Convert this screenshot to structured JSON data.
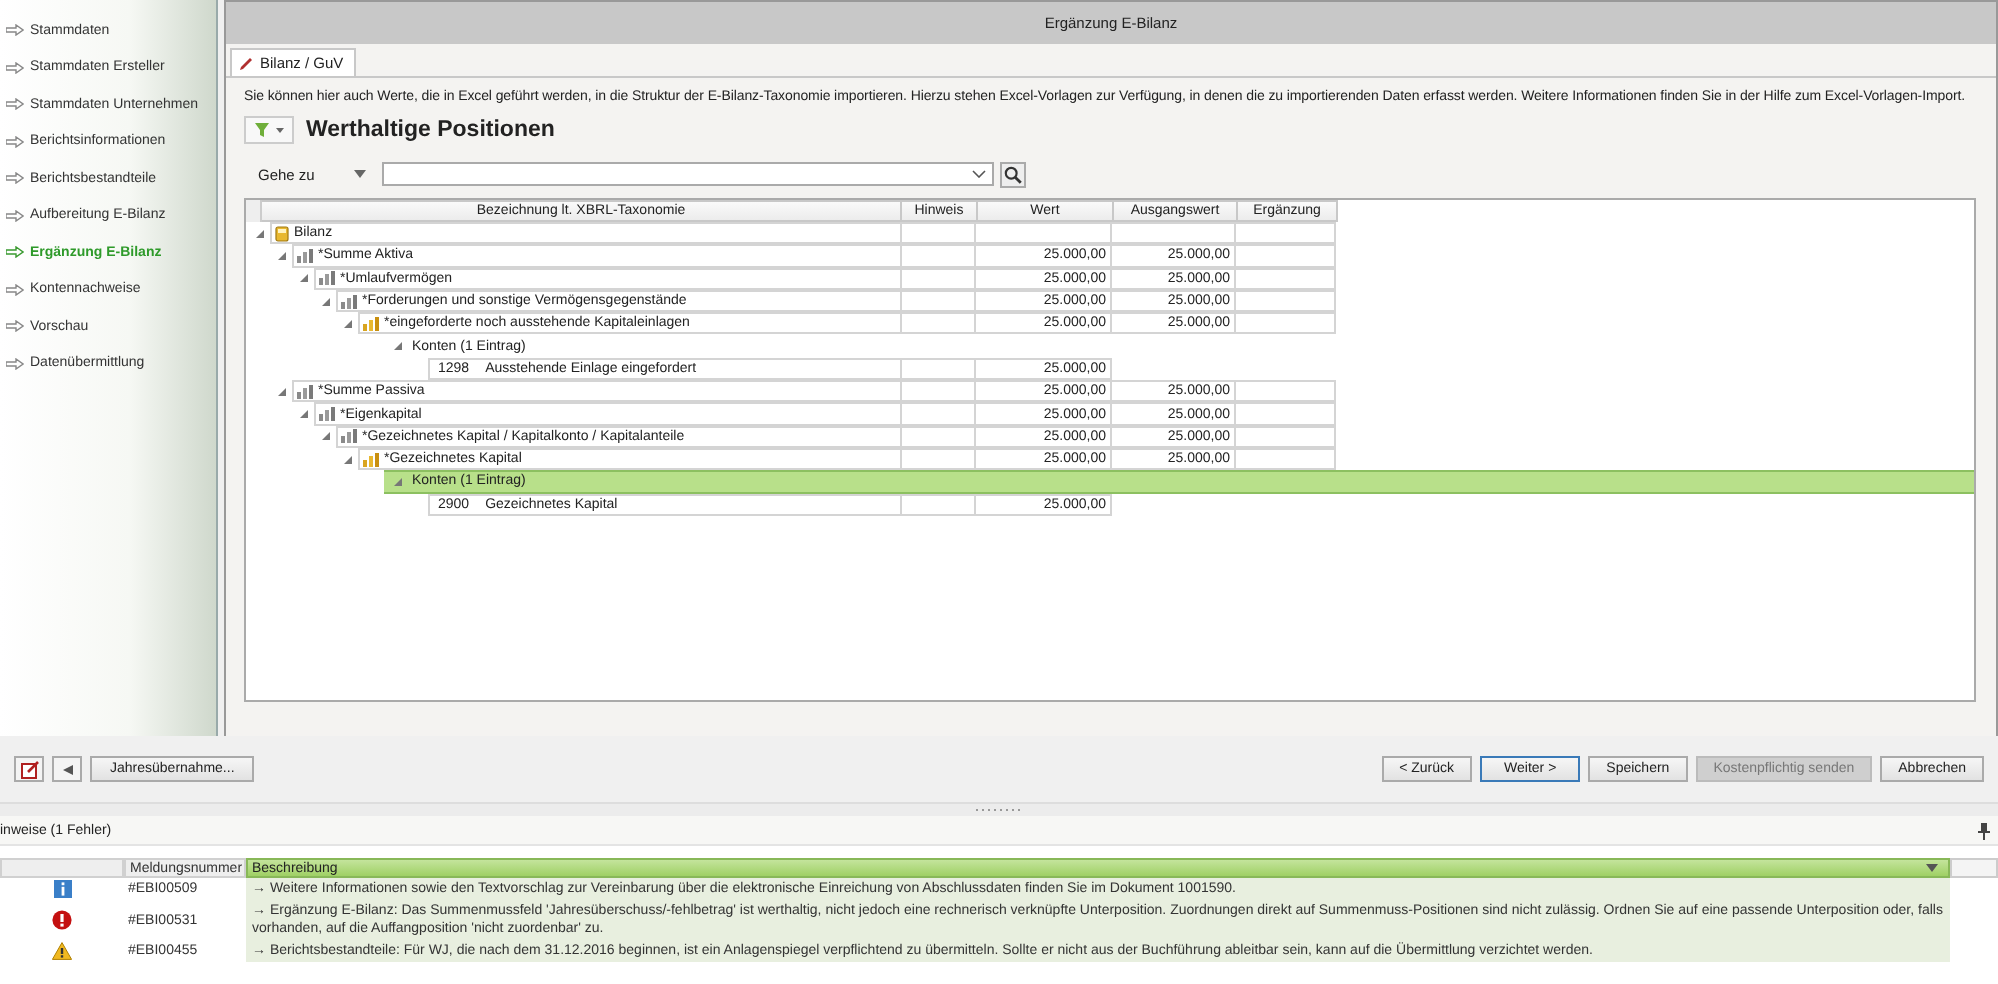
{
  "sidebar": {
    "items": [
      {
        "label": "Stammdaten",
        "selected": false
      },
      {
        "label": "Stammdaten Ersteller",
        "selected": false
      },
      {
        "label": "Stammdaten Unternehmen",
        "selected": false
      },
      {
        "label": "Berichtsinformationen",
        "selected": false
      },
      {
        "label": "Berichtsbestandteile",
        "selected": false
      },
      {
        "label": "Aufbereitung E-Bilanz",
        "selected": false
      },
      {
        "label": "Ergänzung E-Bilanz",
        "selected": true
      },
      {
        "label": "Kontennachweise",
        "selected": false
      },
      {
        "label": "Vorschau",
        "selected": false
      },
      {
        "label": "Datenübermittlung",
        "selected": false
      }
    ]
  },
  "window": {
    "title": "Ergänzung E-Bilanz"
  },
  "tabs": [
    {
      "label": "Bilanz / GuV",
      "selected": true
    }
  ],
  "description": "Sie können hier auch Werte, die in Excel geführt werden, in die Struktur der E-Bilanz-Taxonomie importieren. Hierzu stehen Excel-Vorlagen zur Verfügung, in denen die zu importierenden Daten erfasst werden. Weitere Informationen finden Sie in der Hilfe zum Excel-Vorlagen-Import.",
  "heading": "Werthaltige Positionen",
  "goto": {
    "label": "Gehe zu"
  },
  "table": {
    "columns": [
      "Bezeichnung lt. XBRL-Taxonomie",
      "Hinweis",
      "Wert",
      "Ausgangswert",
      "Ergänzung"
    ],
    "rows": [
      {
        "kind": "root",
        "label": "Bilanz",
        "expanded": true,
        "children": [
          {
            "kind": "group",
            "label": "*Summe Aktiva",
            "wert": "25.000,00",
            "ausgangswert": "25.000,00",
            "expanded": true,
            "children": [
              {
                "kind": "group",
                "label": "*Umlaufvermögen",
                "wert": "25.000,00",
                "ausgangswert": "25.000,00",
                "expanded": true,
                "children": [
                  {
                    "kind": "group",
                    "label": "*Forderungen und sonstige Vermögensgegenstände",
                    "wert": "25.000,00",
                    "ausgangswert": "25.000,00",
                    "expanded": true,
                    "children": [
                      {
                        "kind": "end",
                        "label": "*eingeforderte noch ausstehende Kapitaleinlagen",
                        "wert": "25.000,00",
                        "ausgangswert": "25.000,00",
                        "expanded": true,
                        "children": [
                          {
                            "kind": "accounts",
                            "label": "Konten (1 Eintrag)",
                            "expanded": true,
                            "selected": false,
                            "children": [
                              {
                                "kind": "account",
                                "number": "1298",
                                "label": "Ausstehende Einlage eingefordert",
                                "wert": "25.000,00"
                              }
                            ]
                          }
                        ]
                      }
                    ]
                  }
                ]
              }
            ]
          },
          {
            "kind": "group",
            "label": "*Summe Passiva",
            "wert": "25.000,00",
            "ausgangswert": "25.000,00",
            "expanded": true,
            "children": [
              {
                "kind": "group",
                "label": "*Eigenkapital",
                "wert": "25.000,00",
                "ausgangswert": "25.000,00",
                "expanded": true,
                "children": [
                  {
                    "kind": "group",
                    "label": "*Gezeichnetes Kapital / Kapitalkonto / Kapitalanteile",
                    "wert": "25.000,00",
                    "ausgangswert": "25.000,00",
                    "expanded": true,
                    "children": [
                      {
                        "kind": "end",
                        "label": "*Gezeichnetes Kapital",
                        "wert": "25.000,00",
                        "ausgangswert": "25.000,00",
                        "expanded": true,
                        "children": [
                          {
                            "kind": "accounts",
                            "label": "Konten (1 Eintrag)",
                            "expanded": true,
                            "selected": true,
                            "children": [
                              {
                                "kind": "account",
                                "number": "2900",
                                "label": "Gezeichnetes Kapital",
                                "wert": "25.000,00"
                              }
                            ]
                          }
                        ]
                      }
                    ]
                  }
                ]
              }
            ]
          }
        ]
      }
    ]
  },
  "actions": {
    "left": [
      {
        "kind": "edit-icon"
      },
      {
        "kind": "back-icon"
      },
      {
        "kind": "text",
        "label": "Jahresübernahme..."
      }
    ],
    "right": [
      {
        "label": "< Zurück",
        "default": false,
        "disabled": false
      },
      {
        "label": "Weiter >",
        "default": true,
        "disabled": false
      },
      {
        "label": "Speichern",
        "default": false,
        "disabled": false
      },
      {
        "label": "Kostenpflichtig senden",
        "default": false,
        "disabled": true
      },
      {
        "label": "Abbrechen",
        "default": false,
        "disabled": false
      }
    ]
  },
  "hints": {
    "title": "inweise (1 Fehler)",
    "columns": [
      "Meldungsnummer",
      "Beschreibung"
    ],
    "messages": [
      {
        "kind": "info",
        "number": "#EBI00509",
        "text": "→ Weitere Informationen sowie den Textvorschlag zur Vereinbarung über die elektronische Einreichung von Abschlussdaten finden Sie im Dokument 1001590."
      },
      {
        "kind": "error",
        "number": "#EBI00531",
        "text": "→ Ergänzung E-Bilanz: Das Summenmussfeld 'Jahresüberschuss/-fehlbetrag' ist werthaltig, nicht jedoch eine rechnerisch verknüpfte Unterposition. Zuordnungen direkt auf Summenmuss-Positionen sind nicht zulässig. Ordnen Sie auf eine passende Unterposition oder, falls vorhanden, auf die Auffangposition 'nicht zuordenbar' zu."
      },
      {
        "kind": "warning",
        "number": "#EBI00455",
        "text": "→ Berichtsbestandteile: Für WJ, die nach dem 31.12.2016 beginnen, ist ein Anlagenspiegel verpflichtend zu übermitteln. Sollte er nicht aus der Buchführung ableitbar sein, kann auf die Übermittlung verzichtet werden."
      }
    ]
  }
}
